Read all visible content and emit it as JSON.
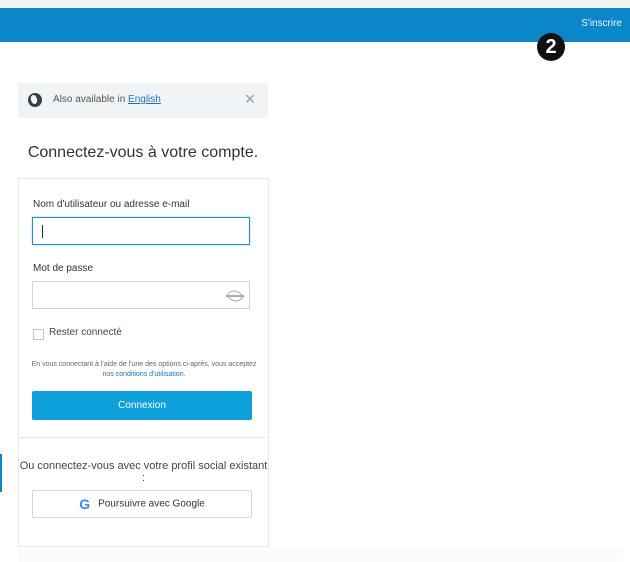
{
  "header": {
    "signup_label": "S'inscrire",
    "step_badge": "2",
    "bar_color": "#0b86c9"
  },
  "language_bar": {
    "prefix": "Also available in ",
    "language_link": "English",
    "close_label": "×"
  },
  "login": {
    "heading": "Connectez-vous à votre compte.",
    "username_label": "Nom d'utilisateur ou adresse e-mail",
    "username_value": "",
    "password_label": "Mot de passe",
    "password_value": "",
    "remember_label": "Rester connecté",
    "legal_text": "En vous connectant à l'aide de l'une des options ci-après, vous acceptez nos",
    "legal_link": "conditions d'utilisation",
    "legal_suffix": ".",
    "submit_label": "Connexion",
    "submit_color": "#0ea0da"
  },
  "social": {
    "prompt": "Ou connectez-vous avec votre profil social existant :",
    "google_icon": "G",
    "google_label": "Poursuivre avec Google"
  }
}
